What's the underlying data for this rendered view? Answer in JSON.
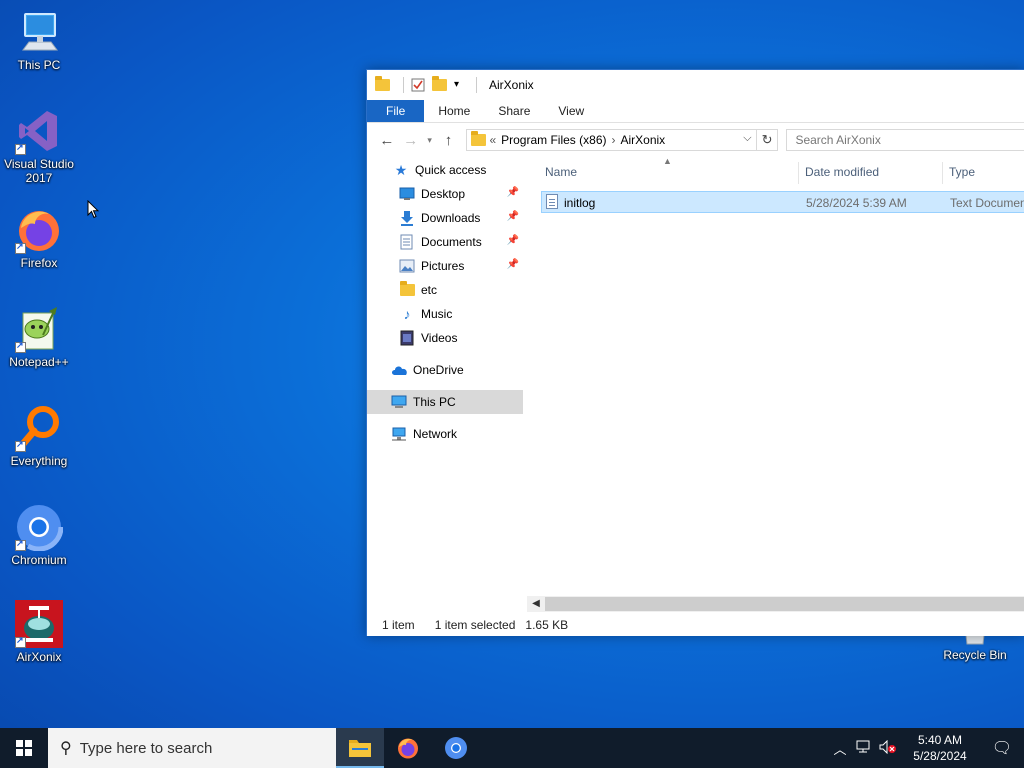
{
  "desktop": {
    "icons": [
      {
        "label": "This PC",
        "icon": "computer-icon"
      },
      {
        "label": "Visual Studio 2017",
        "icon": "visual-studio-icon"
      },
      {
        "label": "Firefox",
        "icon": "firefox-icon"
      },
      {
        "label": "Notepad++",
        "icon": "notepadpp-icon"
      },
      {
        "label": "Everything",
        "icon": "everything-search-icon"
      },
      {
        "label": "Chromium",
        "icon": "chromium-icon"
      },
      {
        "label": "AirXonix",
        "icon": "airxonix-icon"
      },
      {
        "label": "Recycle Bin",
        "icon": "recycle-bin-icon"
      }
    ]
  },
  "explorer": {
    "title": "AirXonix",
    "ribbon_tabs": [
      "File",
      "Home",
      "Share",
      "View"
    ],
    "address": {
      "separator": "«",
      "crumbs": [
        "Program Files (x86)",
        "AirXonix"
      ]
    },
    "search_placeholder": "Search AirXonix",
    "nav": {
      "quick_access": "Quick access",
      "items": [
        {
          "label": "Desktop",
          "pinned": true
        },
        {
          "label": "Downloads",
          "pinned": true
        },
        {
          "label": "Documents",
          "pinned": true
        },
        {
          "label": "Pictures",
          "pinned": true
        },
        {
          "label": "etc",
          "pinned": false
        },
        {
          "label": "Music",
          "pinned": false
        },
        {
          "label": "Videos",
          "pinned": false
        }
      ],
      "onedrive": "OneDrive",
      "this_pc": "This PC",
      "network": "Network"
    },
    "columns": {
      "name": "Name",
      "date": "Date modified",
      "type": "Type"
    },
    "files": [
      {
        "name": "initlog",
        "date": "5/28/2024 5:39 AM",
        "type": "Text Document"
      }
    ],
    "status": {
      "count": "1 item",
      "selected": "1 item selected",
      "size": "1.65 KB"
    }
  },
  "taskbar": {
    "search_placeholder": "Type here to search",
    "time": "5:40 AM",
    "date": "5/28/2024"
  },
  "colors": {
    "accent": "#1966c4",
    "selection": "#cce8ff",
    "taskbar": "#101c2b"
  }
}
